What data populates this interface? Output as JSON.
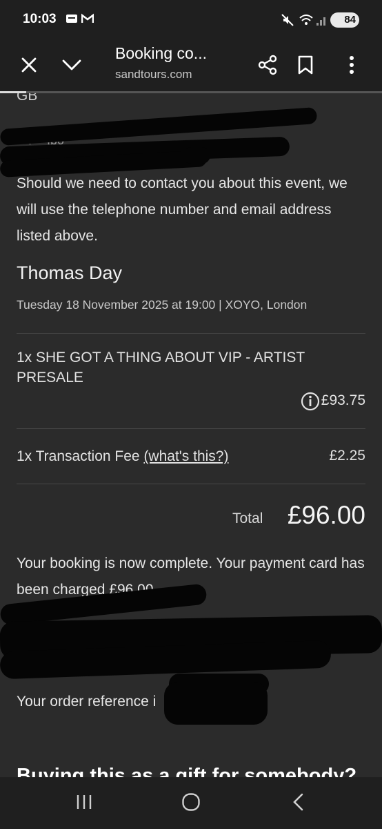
{
  "status_bar": {
    "time": "10:03",
    "battery": "84",
    "icons": [
      "mail-icon",
      "gmail-icon",
      "mute-icon",
      "wifi-icon",
      "signal-icon",
      "battery-icon"
    ]
  },
  "toolbar": {
    "title": "Booking co...",
    "url": "sandtours.com",
    "icons": [
      "close-icon",
      "chevron-down-icon",
      "share-icon",
      "bookmark-icon",
      "more-vert-icon"
    ]
  },
  "content": {
    "country": "GB",
    "contact_note": "Should we need to contact you about this event, we will use the telephone number and email address listed above.",
    "event": {
      "name": "Thomas Day",
      "meta": "Tuesday 18 November 2025 at 19:00 | XOYO, London"
    },
    "line_items": [
      {
        "label": "1x SHE GOT A THING ABOUT VIP - ARTIST PRESALE",
        "price": "£93.75"
      },
      {
        "label": "1x Transaction Fee",
        "link": "(what's this?)",
        "price": "£2.25"
      }
    ],
    "total": {
      "label": "Total",
      "value": "£96.00"
    },
    "booking_complete": "Your booking is now complete. Your payment card has been charged £96.00.",
    "order_reference": "Your order reference i",
    "gift_heading": "Buying this as a gift for somebody?"
  },
  "colors": {
    "background": "#2b2b2b",
    "bars": "#1f1f1f",
    "redaction": "#050505"
  }
}
